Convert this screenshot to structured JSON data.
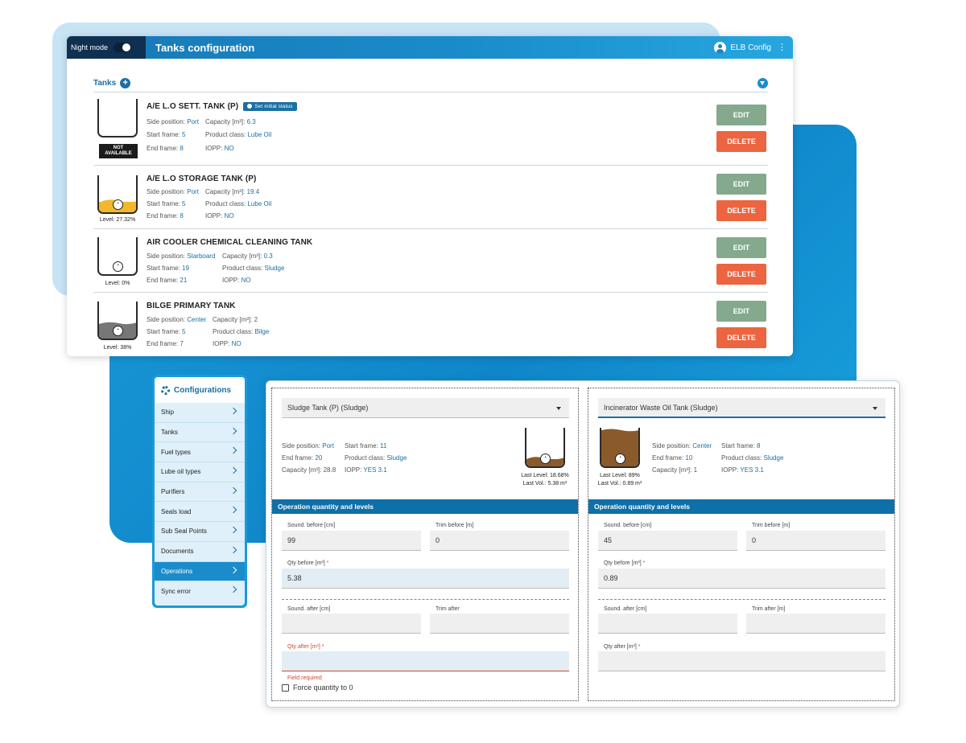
{
  "header": {
    "night_mode_label": "Night mode",
    "title": "Tanks configuration",
    "user_label": "ELB Config"
  },
  "tanks_section": {
    "label": "Tanks",
    "add": "+"
  },
  "tanks": [
    {
      "name": "A/E L.O SETT. TANK (P)",
      "badge": "Set initial status",
      "na_line1": "NOT",
      "na_line2": "AVAILABLE",
      "side_label": "Side position:",
      "side": "Port",
      "capacity_label": "Capacity [m³]:",
      "capacity": "6.3",
      "start_label": "Start frame:",
      "start": "5",
      "product_label": "Product class:",
      "product": "Lube Oil",
      "end_label": "End frame:",
      "end": "8",
      "iopp_label": "IOPP:",
      "iopp": "NO",
      "level": ""
    },
    {
      "name": "A/E L.O STORAGE TANK (P)",
      "side_label": "Side position:",
      "side": "Port",
      "capacity_label": "Capacity [m³]:",
      "capacity": "19.4",
      "start_label": "Start frame:",
      "start": "5",
      "product_label": "Product class:",
      "product": "Lube Oil",
      "end_label": "End frame:",
      "end": "8",
      "iopp_label": "IOPP:",
      "iopp": "NO",
      "level": "Level: 27.32%"
    },
    {
      "name": "AIR COOLER CHEMICAL CLEANING TANK",
      "side_label": "Side position:",
      "side": "Starboard",
      "capacity_label": "Capacity [m³]:",
      "capacity": "0.3",
      "start_label": "Start frame:",
      "start": "19",
      "product_label": "Product class:",
      "product": "Sludge",
      "end_label": "End frame:",
      "end": "21",
      "iopp_label": "IOPP:",
      "iopp": "NO",
      "level": "Level: 0%"
    },
    {
      "name": "BILGE PRIMARY TANK",
      "side_label": "Side position:",
      "side": "Center",
      "capacity_label": "Capacity [m³]:",
      "capacity": "2",
      "start_label": "Start frame:",
      "start": "5",
      "product_label": "Product class:",
      "product": "Bilge",
      "end_label": "End frame:",
      "end": "7",
      "iopp_label": "IOPP:",
      "iopp": "NO",
      "level": "Level: 38%"
    }
  ],
  "tank_levels": [
    0,
    27.32,
    0,
    38
  ],
  "buttons": {
    "edit": "EDIT",
    "delete": "DELETE"
  },
  "sidebar": {
    "title": "Configurations",
    "items": [
      "Ship",
      "Tanks",
      "Fuel types",
      "Lube oil types",
      "Purifiers",
      "Seals load",
      "Sub Seal Points",
      "Documents",
      "Operations",
      "Sync error"
    ],
    "active": "Operations"
  },
  "ops": {
    "left": {
      "select": "Sludge Tank (P) (Sludge)",
      "side_label": "Side position:",
      "side": "Port",
      "start_label": "Start frame:",
      "start": "11",
      "end_label": "End frame:",
      "end": "20",
      "product_label": "Product class:",
      "product": "Sludge",
      "capacity_label": "Capacity [m³]:",
      "capacity": "28.8",
      "iopp_label": "IOPP:",
      "iopp": "YES 3.1",
      "last_level": "Last Level: 18.68%",
      "last_vol": "Last Vol.: 5.38 m³",
      "level_pct": 18.68,
      "section": "Operation quantity and levels",
      "sound_before_label": "Sound. before [cm]",
      "sound_before": "99",
      "trim_before_label": "Trim before [m]",
      "trim_before": "0",
      "qty_before_label": "Qty before [m³]",
      "qty_before": "5.38",
      "sound_after_label": "Sound. after [cm]",
      "sound_after": "",
      "trim_after_label": "Trim after",
      "trim_after": "",
      "qty_after_label": "Qty after [m³]",
      "qty_after": "",
      "error": "Field required",
      "force_label": "Force quantity to 0",
      "required_mark": "*"
    },
    "right": {
      "select": "Incinerator Waste Oil Tank (Sludge)",
      "side_label": "Side position:",
      "side": "Center",
      "start_label": "Start frame:",
      "start": "8",
      "end_label": "End frame:",
      "end": "10",
      "product_label": "Product class:",
      "product": "Sludge",
      "capacity_label": "Capacity [m³]:",
      "capacity": "1",
      "iopp_label": "IOPP:",
      "iopp": "YES 3.1",
      "last_level": "Last Level: 89%",
      "last_vol": "Last Vol.: 0.89 m³",
      "level_pct": 89,
      "section": "Operation quantity and levels",
      "sound_before_label": "Sound. before [cm]",
      "sound_before": "45",
      "trim_before_label": "Trim before [m]",
      "trim_before": "0",
      "qty_before_label": "Qty before [m³]",
      "qty_before": "0.89",
      "sound_after_label": "Sound. after [cm]",
      "sound_after": "",
      "trim_after_label": "Trim after [m]",
      "trim_after": "",
      "qty_after_label": "Qty after [m³]",
      "qty_after": "",
      "required_mark": "*"
    }
  },
  "colors": {
    "brand_blue": "#1a8ccb",
    "edit_green": "#84a98c",
    "delete_red": "#ec6440",
    "lube_fill": "#f1b82d",
    "bilge_fill": "#777777",
    "sludge_fill": "#8a5a2b"
  }
}
